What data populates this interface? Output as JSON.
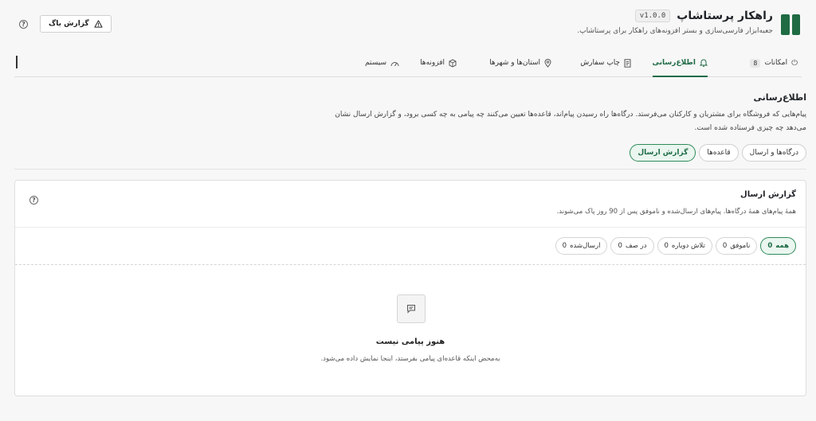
{
  "header": {
    "title": "راهکار پرستاشاپ",
    "version": "v1.0.0",
    "subtitle": "جعبه‌ابزار فارسی‌سازی و بستر افزونه‌های راهکار برای پرستاشاپ.",
    "bug_report_label": "گزارش باگ",
    "help_icon": "?",
    "brand_color": "#1f6b43"
  },
  "tabs": [
    {
      "label": "امکانات",
      "count": "8",
      "icon": "power-icon",
      "active": false
    },
    {
      "label": "اطلاع‌رسانی",
      "icon": "bell-icon",
      "active": true
    },
    {
      "label": "چاپ سفارش",
      "icon": "document-icon",
      "active": false
    },
    {
      "label": "استان‌ها و شهرها",
      "icon": "map-pin-icon",
      "active": false
    },
    {
      "label": "افزونه‌ها",
      "icon": "cube-icon",
      "active": false
    },
    {
      "label": "سیستم",
      "icon": "gauge-icon",
      "active": false
    }
  ],
  "section": {
    "title": "اطلاع‌رسانی",
    "description": "پیام‌هایی که فروشگاه برای مشتریان و کارکنان می‌فرستد. درگاه‌ها راه رسیدن پیام‌اند، قاعده‌ها تعیین می‌کنند چه پیامی به چه کسی برود، و گزارش ارسال نشان می‌دهد چه چیزی فرستاده شده است."
  },
  "subtabs": [
    {
      "label": "درگاه‌ها و ارسال",
      "active": false
    },
    {
      "label": "قاعده‌ها",
      "active": false
    },
    {
      "label": "گزارش ارسال",
      "active": true
    }
  ],
  "card": {
    "title": "گزارش ارسال",
    "description": "همهٔ پیام‌های همهٔ درگاه‌ها. پیام‌های ارسال‌شده و ناموفق پس از 90 روز پاک می‌شوند.",
    "help_icon": "?"
  },
  "filters": [
    {
      "label": "همه",
      "count": "0",
      "active": true
    },
    {
      "label": "ناموفق",
      "count": "0",
      "active": false
    },
    {
      "label": "تلاش دوباره",
      "count": "0",
      "active": false
    },
    {
      "label": "در صف",
      "count": "0",
      "active": false
    },
    {
      "label": "ارسال‌شده",
      "count": "0",
      "active": false
    }
  ],
  "empty_state": {
    "icon": "message-icon",
    "title": "هنوز پیامی نیست",
    "subtitle": "به‌محض اینکه قاعده‌ای پیامی بفرستد، اینجا نمایش داده می‌شود."
  },
  "colors": {
    "accent": "#1e6b46",
    "accent_bg": "#eaf6ef"
  }
}
